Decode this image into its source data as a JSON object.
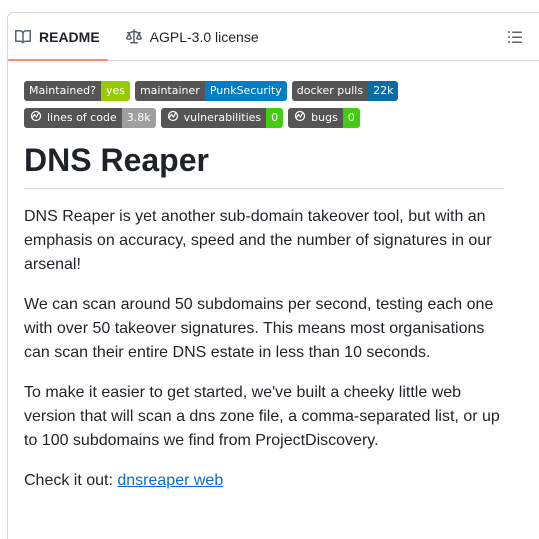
{
  "tabs": [
    {
      "label": "README",
      "icon": "book-icon",
      "active": true
    },
    {
      "label": "AGPL-3.0 license",
      "icon": "scale-icon",
      "active": false
    }
  ],
  "badges_row1": [
    {
      "label": "Maintained?",
      "value": "yes",
      "color": "#97ca00"
    },
    {
      "label": "maintainer",
      "value": "PunkSecurity",
      "color": "#007ec6"
    },
    {
      "label": "docker pulls",
      "value": "22k",
      "color": "#066da5"
    }
  ],
  "badges_row2": [
    {
      "label": "lines of code",
      "value": "3.8k",
      "color": "#9f9f9f",
      "icon": "sonarcloud-icon"
    },
    {
      "label": "vulnerabilities",
      "value": "0",
      "color": "#44cc11",
      "icon": "sonarcloud-icon"
    },
    {
      "label": "bugs",
      "value": "0",
      "color": "#44cc11",
      "icon": "sonarcloud-icon"
    }
  ],
  "readme": {
    "title": "DNS Reaper",
    "paragraphs": [
      "DNS Reaper is yet another sub-domain takeover tool, but with an emphasis on accuracy, speed and the number of signatures in our arsenal!",
      "We can scan around 50 subdomains per second, testing each one with over 50 takeover signatures. This means most organisations can scan their entire DNS estate in less than 10 seconds.",
      "To make it easier to get started, we've built a cheeky little web version that will scan a dns zone file, a comma-separated list, or up to 100 subdomains we find from ProjectDiscovery."
    ],
    "check_prefix": "Check it out: ",
    "check_link": "dnsreaper web"
  },
  "colors": {
    "tab_underline": "#fd8c73",
    "link": "#0969da"
  }
}
